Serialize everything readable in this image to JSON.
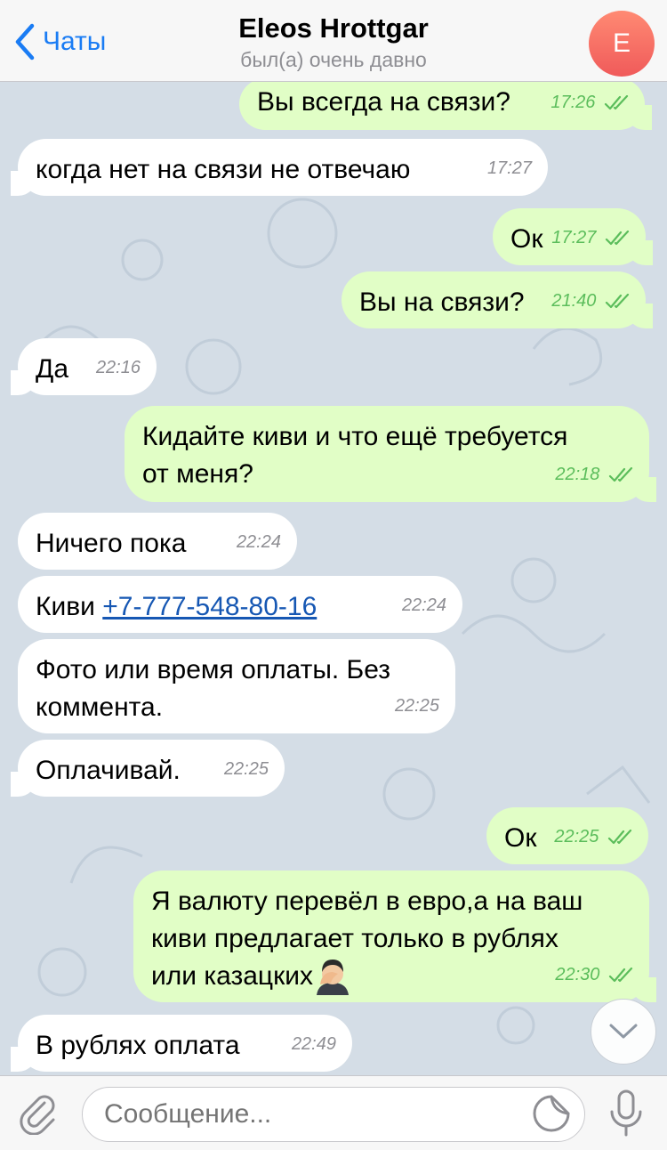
{
  "header": {
    "back_label": "Чаты",
    "title": "Eleos Hrottgar",
    "status": "был(а) очень давно",
    "avatar_letter": "E"
  },
  "messages": [
    {
      "dir": "out",
      "text": "Вы всегда на связи?",
      "time": "17:26",
      "read": true
    },
    {
      "dir": "in",
      "text": "когда нет на связи не отвечаю",
      "time": "17:27"
    },
    {
      "dir": "out",
      "text": "Ок",
      "time": "17:27",
      "read": true
    },
    {
      "dir": "out",
      "text": "Вы на связи?",
      "time": "21:40",
      "read": true
    },
    {
      "dir": "in",
      "text": "Да",
      "time": "22:16"
    },
    {
      "dir": "out",
      "text": "Кидайте киви и что ещё требуется\nот меня?",
      "time": "22:18",
      "read": true
    },
    {
      "dir": "in",
      "text": "Ничего пока",
      "time": "22:24"
    },
    {
      "dir": "in",
      "prefix": "Киви ",
      "link": "+7-777-548-80-16",
      "time": "22:24"
    },
    {
      "dir": "in",
      "text": "Фото или время оплаты. Без\nкоммента.",
      "time": "22:25"
    },
    {
      "dir": "in",
      "text": "Оплачивай.",
      "time": "22:25"
    },
    {
      "dir": "out",
      "text": "Ок",
      "time": "22:25",
      "read": true
    },
    {
      "dir": "out",
      "text": "Я валюту перевёл в евро,а на ваш\nкиви предлагает только в рублях\nили казацких",
      "emoji": "facepalm-emoji",
      "time": "22:30",
      "read": true
    },
    {
      "dir": "in",
      "text": "В рублях оплата",
      "time": "22:49"
    }
  ],
  "input": {
    "placeholder": "Сообщение..."
  },
  "colors": {
    "accent": "#1a7cf4",
    "outgoing_bubble": "#e1fec6",
    "incoming_bubble": "#ffffff",
    "read_check": "#5bbd5b",
    "chat_background": "#d4dde6"
  }
}
